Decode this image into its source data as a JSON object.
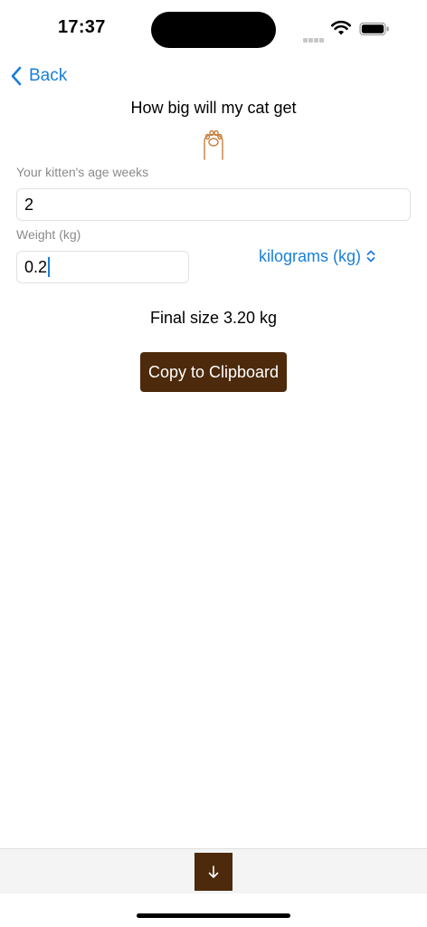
{
  "status_bar": {
    "time": "17:37"
  },
  "nav": {
    "back_label": "Back"
  },
  "page": {
    "title": "How big will my cat get"
  },
  "form": {
    "age_label": "Your kitten's age weeks",
    "age_value": "2",
    "weight_label": "Weight (kg)",
    "weight_value": "0.2",
    "unit_selected": "kilograms (kg)"
  },
  "result": {
    "text": "Final size 3.20 kg"
  },
  "actions": {
    "copy_label": "Copy to Clipboard"
  },
  "colors": {
    "accent": "#1a7fd8",
    "button_brown": "#4c2a0b",
    "paw_orange": "#c9803e"
  },
  "icons": {
    "back": "chevron-left-icon",
    "paw": "paw-icon",
    "unit_select": "chevron-up-down-icon",
    "scroll_down": "arrow-down-icon"
  }
}
